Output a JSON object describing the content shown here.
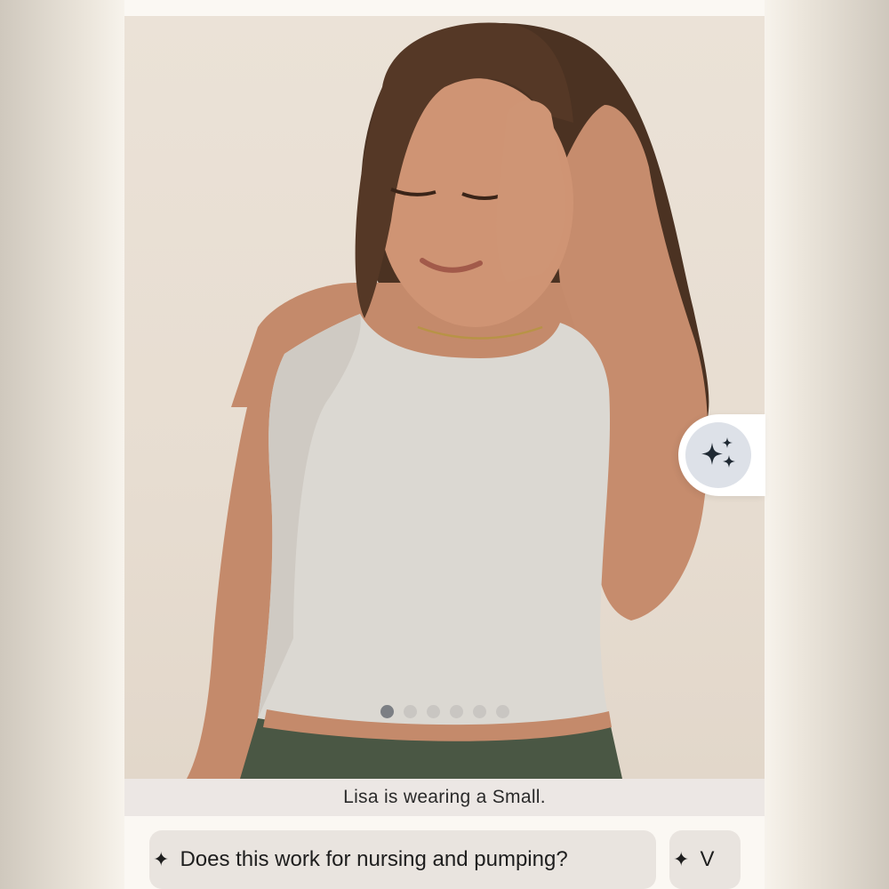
{
  "photo": {
    "alt": "",
    "dots_total": 6,
    "dots_active_index": 0
  },
  "caption": "Lisa is wearing a Small.",
  "chips": [
    {
      "label": "Does this work for nursing and pumping?",
      "icon": "sparkle-icon"
    },
    {
      "label": "V",
      "icon": "sparkle-icon"
    }
  ],
  "ai_button": {
    "icon": "sparkles-icon"
  },
  "colors": {
    "caption_bg": "#ece7e4",
    "chip_bg": "#e9e4df",
    "ai_button_bg": "#dde1e8",
    "dot_active": "#7c7f84",
    "dot_inactive": "#c9c6c2"
  }
}
